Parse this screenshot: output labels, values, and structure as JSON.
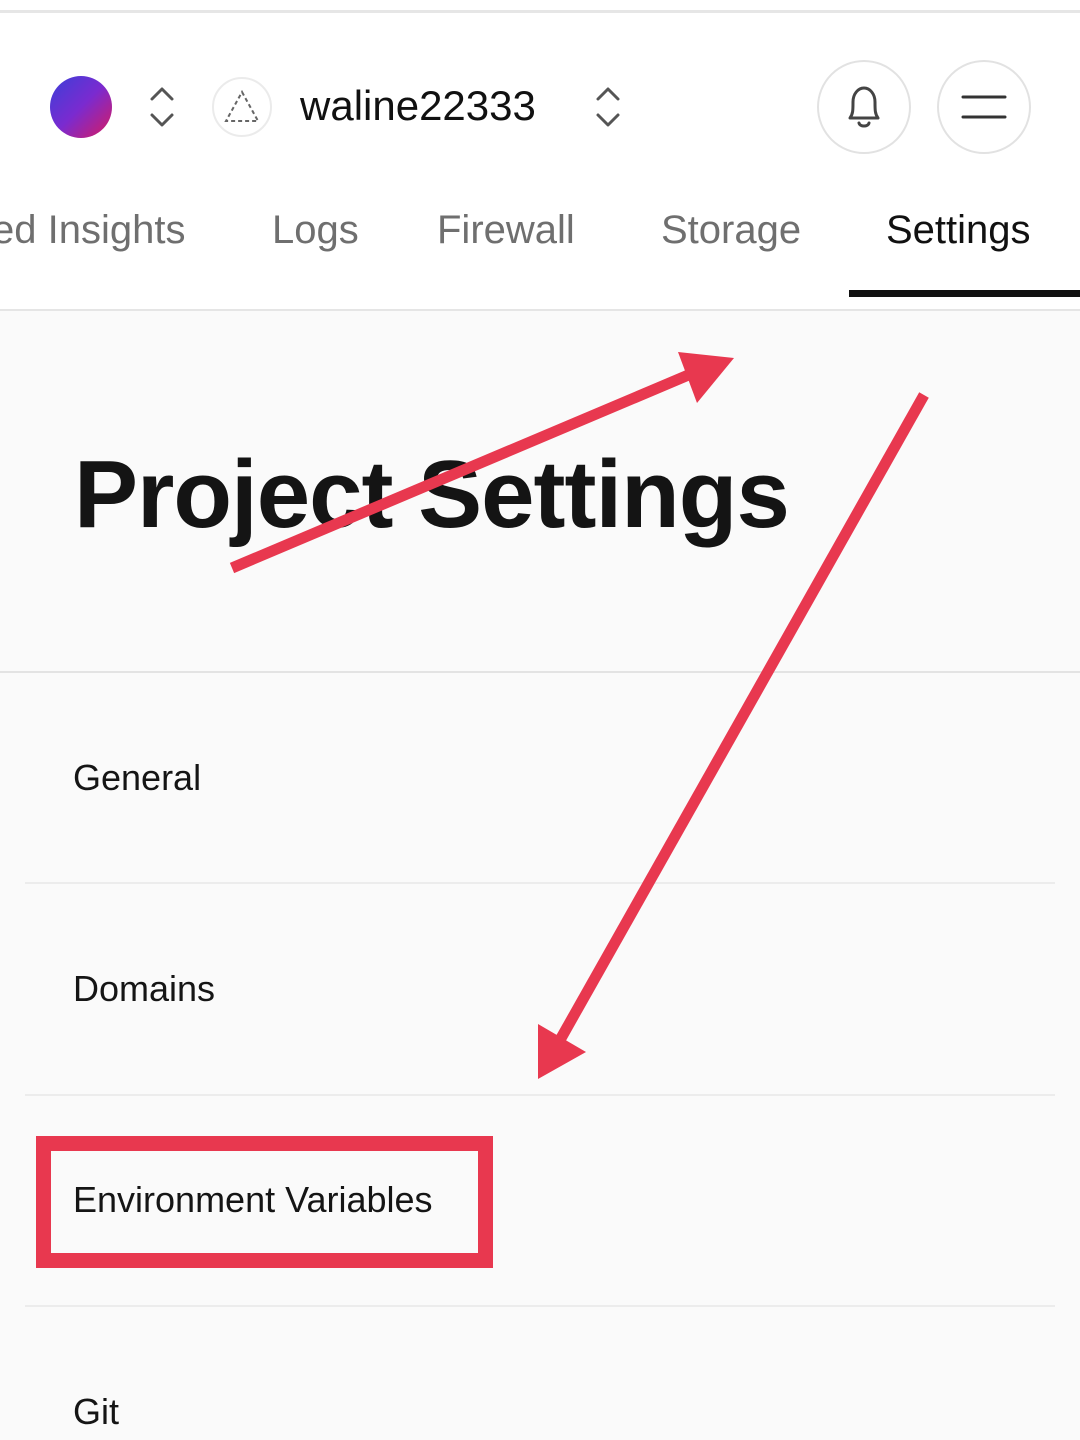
{
  "header": {
    "project_name": "waline22333",
    "icons": {
      "team_switcher": "chevron-up-down-icon",
      "project": "triangle-icon",
      "project_switcher": "chevron-up-down-icon",
      "notifications": "bell-icon",
      "menu": "menu-icon"
    },
    "avatar_gradient": [
      "#3b3fd8",
      "#d81b60"
    ]
  },
  "tabs": [
    {
      "label": "ed Insights",
      "active": false
    },
    {
      "label": "Logs",
      "active": false
    },
    {
      "label": "Firewall",
      "active": false
    },
    {
      "label": "Storage",
      "active": false
    },
    {
      "label": "Settings",
      "active": true
    }
  ],
  "page": {
    "title": "Project Settings"
  },
  "settings_nav": [
    {
      "label": "General"
    },
    {
      "label": "Domains"
    },
    {
      "label": "Environment Variables",
      "highlighted": true
    },
    {
      "label": "Git"
    }
  ],
  "annotation": {
    "color": "#e8384f"
  }
}
